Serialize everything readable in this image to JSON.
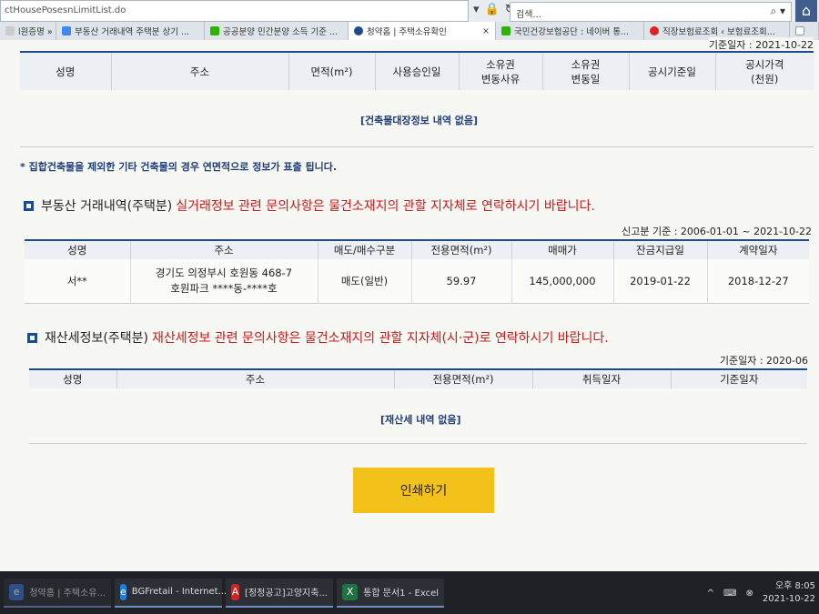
{
  "browser": {
    "address_text": "ctHousePosesnLimitList.do",
    "search_placeholder": "검색...",
    "tabs": [
      {
        "label": "l원증명 » ...",
        "color": "#cccccc",
        "active": false
      },
      {
        "label": "부동산 거래내역 주택분 상기 ...",
        "color": "#4285f4",
        "active": false
      },
      {
        "label": "공공분양 민간분양 소득 기준 ...",
        "color": "#2db400",
        "active": false
      },
      {
        "label": "청약홈 | 주택소유확인",
        "color": "#1e4b8f",
        "active": true
      },
      {
        "label": "국민건강보험공단 : 네이버 통...",
        "color": "#2db400",
        "active": false
      },
      {
        "label": "직장보험료조회 ‹ 보험료조회...",
        "color": "#d22",
        "active": false
      }
    ]
  },
  "building_section": {
    "ref_date": "기준일자 : 2021-10-22",
    "headers": [
      "성명",
      "주소",
      "면적(m²)",
      "사용승인일",
      "소유권\n변동사유",
      "소유권\n변동일",
      "공시기준일",
      "공시가격\n(천원)"
    ],
    "empty_message": "[건축물대장정보 내역 없음]",
    "note": "* 집합건축물을 제외한 기타 건축물의 경우 연면적으로 정보가 표출 됩니다."
  },
  "transaction_section": {
    "title": "부동산 거래내역(주택분)",
    "notice": "실거래정보 관련 문의사항은 물건소재지의 관할 지자체로 연락하시기 바랍니다.",
    "ref_date": "신고분 기준 : 2006-01-01 ~ 2021-10-22",
    "headers": [
      "성명",
      "주소",
      "매도/매수구분",
      "전용면적(m²)",
      "매매가",
      "잔금지급일",
      "계약일자"
    ],
    "rows": [
      {
        "name": "서**",
        "address": "경기도 의정부시 호원동 468-7\n호원파크 ****동-****호",
        "type": "매도(일반)",
        "area": "59.97",
        "price": "145,000,000",
        "balance_date": "2019-01-22",
        "contract_date": "2018-12-27"
      }
    ]
  },
  "property_tax_section": {
    "title": "재산세정보(주택분)",
    "notice": "재산세정보 관련 문의사항은 물건소재지의 관할 지자체(시·군)로 연락하시기 바랍니다.",
    "ref_date": "기준일자 : 2020-06",
    "headers": [
      "성명",
      "주소",
      "전용면적(m²)",
      "취득일자",
      "기준일자"
    ],
    "empty_message": "[재산세 내역 없음]"
  },
  "print_button": "인쇄하기",
  "taskbar": {
    "items": [
      {
        "label": "청약홈 | 주택소유...",
        "icon": "edge-icon",
        "color": "#3a6cc4"
      },
      {
        "label": "BGFretail - Internet...",
        "icon": "ie-icon",
        "color": "#1e7fd4"
      },
      {
        "label": "[정정공고]고양지축...",
        "icon": "pdf-icon",
        "color": "#c62828"
      },
      {
        "label": "통합 문서1 - Excel",
        "icon": "excel-icon",
        "color": "#1f7244"
      }
    ],
    "ampm": "오후",
    "time": "8:05",
    "date": "2021-10-22"
  }
}
